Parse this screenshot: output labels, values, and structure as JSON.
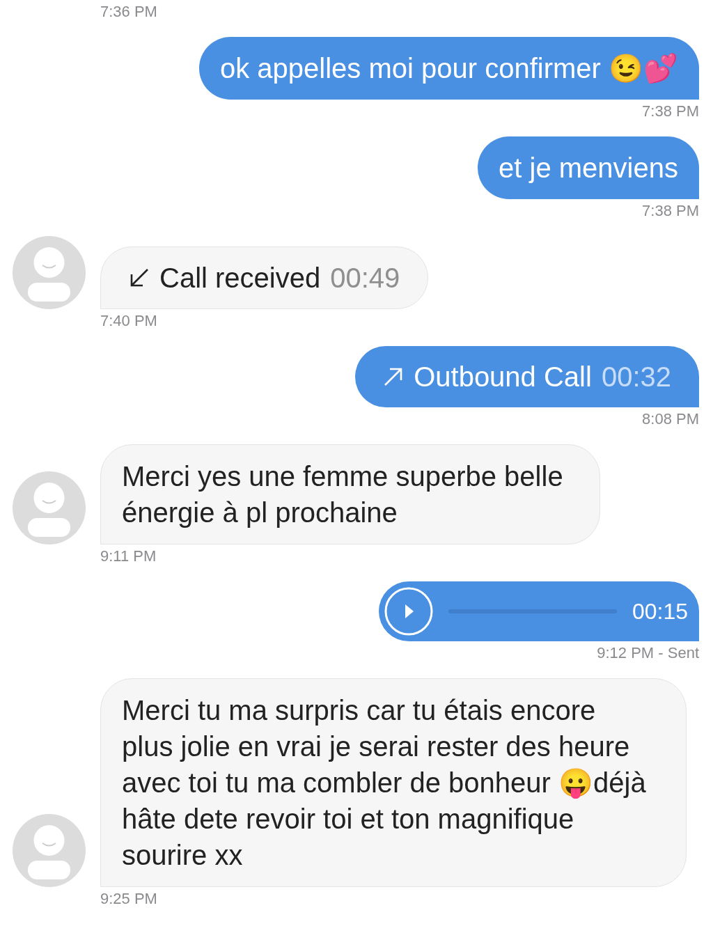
{
  "messages": [
    {
      "kind": "time_only",
      "outgoing": false,
      "time": "7:36 PM"
    },
    {
      "kind": "text",
      "outgoing": true,
      "text": "ok appelles moi pour confirmer 😉💕",
      "time": "7:38 PM"
    },
    {
      "kind": "text",
      "outgoing": true,
      "text": "et je menviens",
      "time": "7:38 PM"
    },
    {
      "kind": "call",
      "outgoing": false,
      "label": "Call received",
      "duration": "00:49",
      "time": "7:40 PM"
    },
    {
      "kind": "call",
      "outgoing": true,
      "label": "Outbound Call",
      "duration": "00:32",
      "time": "8:08 PM"
    },
    {
      "kind": "text",
      "outgoing": false,
      "text": "Merci yes une femme superbe belle énergie à pl prochaine",
      "time": "9:11 PM"
    },
    {
      "kind": "audio",
      "outgoing": true,
      "duration": "00:15",
      "time": "9:12 PM - Sent"
    },
    {
      "kind": "text",
      "outgoing": false,
      "text": "Merci tu ma surpris car tu étais encore plus jolie en vrai je serai rester des heure avec toi tu ma combler de bonheur 😛déjà hâte dete revoir toi et ton magnifique sourire xx",
      "time": "9:25 PM"
    }
  ]
}
